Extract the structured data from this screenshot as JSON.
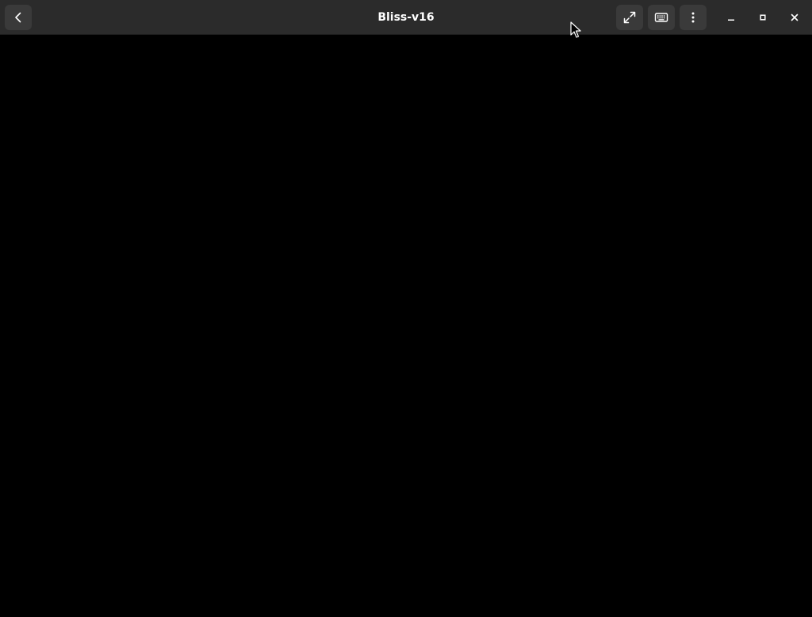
{
  "window": {
    "title": "Bliss-v16"
  },
  "headerbar": {
    "back_icon": "chevron-left-icon",
    "fullscreen_icon": "fullscreen-icon",
    "keyboard_icon": "keyboard-icon",
    "menu_icon": "vertical-ellipsis-icon",
    "minimize_icon": "minimize-icon",
    "maximize_icon": "maximize-icon",
    "close_icon": "close-icon"
  },
  "colors": {
    "headerbar_bg": "#2b2b2b",
    "button_bg": "#3a3a3a",
    "content_bg": "#000000",
    "text": "#ffffff"
  }
}
